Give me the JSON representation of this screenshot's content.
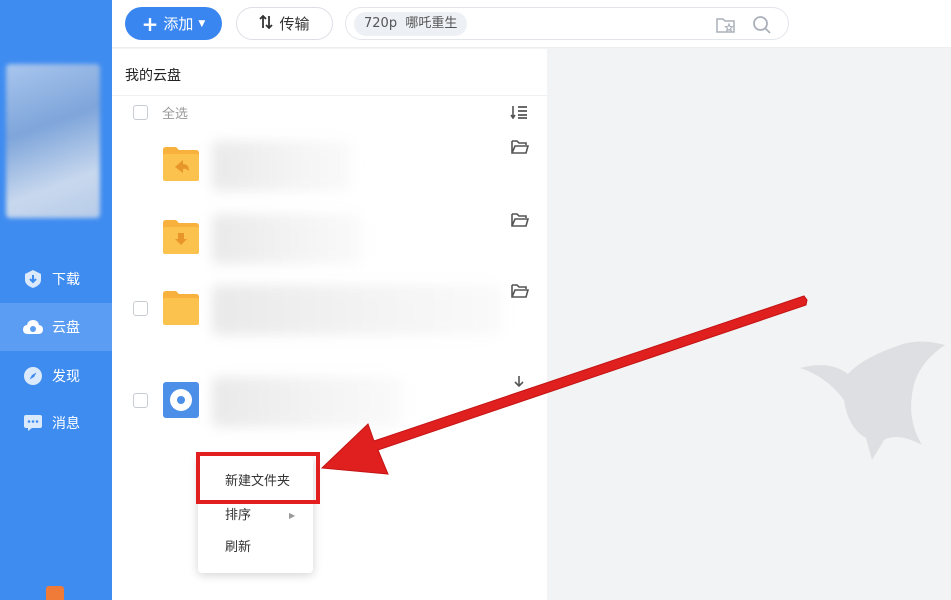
{
  "toolbar": {
    "add_label": "添加",
    "transfer_label": "传输"
  },
  "search": {
    "tag": "720p",
    "query": "哪吒重生"
  },
  "sidebar": {
    "items": [
      {
        "label": "下载",
        "icon": "download-shield-icon"
      },
      {
        "label": "云盘",
        "icon": "cloud-icon"
      },
      {
        "label": "发现",
        "icon": "compass-icon"
      },
      {
        "label": "消息",
        "icon": "message-icon"
      }
    ]
  },
  "panel": {
    "breadcrumb": "我的云盘",
    "select_all": "全选"
  },
  "context_menu": {
    "items": [
      "新建文件夹",
      "排序",
      "刷新"
    ]
  },
  "colors": {
    "accent": "#3a86f0",
    "sidebar": "#3f8cf0",
    "folder": "#f7b13c",
    "highlight": "#e21e1e"
  }
}
